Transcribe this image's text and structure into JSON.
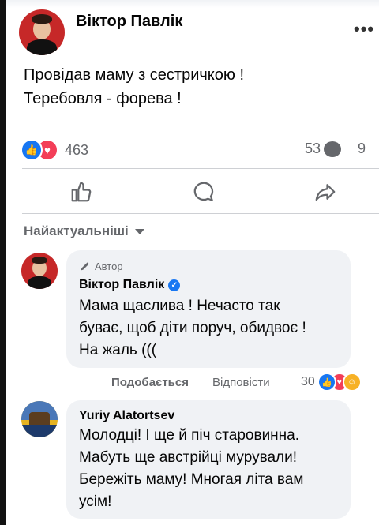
{
  "post": {
    "author": "Віктор Павлік",
    "text": "Провідав маму з сестричкою !\nТеребовля - форева !",
    "reactions_count": "463",
    "comments_count": "53",
    "shares_count": "9"
  },
  "sort_label": "Найактуальніші",
  "comments": [
    {
      "badge": "Автор",
      "name": "Віктор Павлік",
      "text": "Мама щаслива ! Нечасто так\nбуває, щоб діти поруч, обидвоє !\nНа жаль (((",
      "like_label": "Подобається",
      "reply_label": "Відповісти",
      "reactions_count": "30"
    },
    {
      "name": "Yuriy Alatortsev",
      "text": "Молодці! І ще й піч старовинна.\nМабуть ще австрійці мурували!\nБережіть маму! Многая літа вам\nусім!"
    }
  ],
  "icons": [
    "more-icon",
    "like-reaction-icon",
    "love-reaction-icon",
    "care-reaction-icon",
    "comment-icon",
    "share-icon",
    "like-action-icon",
    "comment-action-icon",
    "share-action-icon",
    "pencil-icon",
    "verified-icon",
    "caret-down-icon"
  ],
  "colors": {
    "accent": "#1877f2",
    "love": "#f33e58",
    "care": "#f7b125",
    "muted": "#65676b",
    "bubble": "#f0f2f5"
  }
}
